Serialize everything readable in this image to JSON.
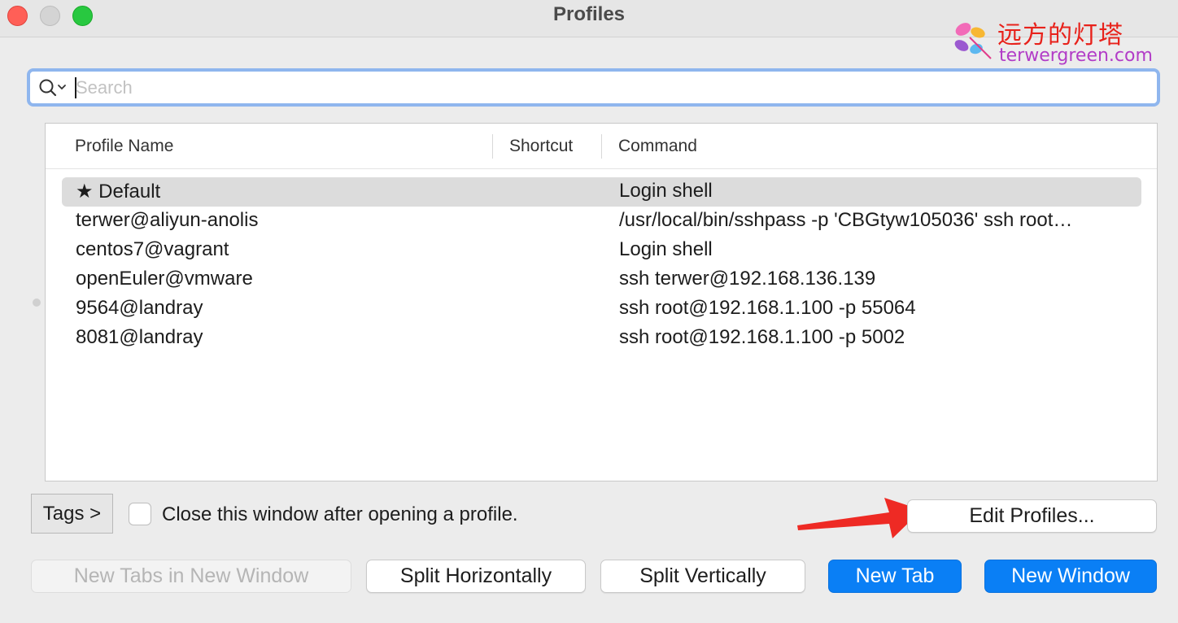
{
  "window": {
    "title": "Profiles"
  },
  "watermark": {
    "chinese": "远方的灯塔",
    "site": "terwergreen.com"
  },
  "search": {
    "placeholder": "Search",
    "value": ""
  },
  "table": {
    "headers": {
      "name": "Profile Name",
      "shortcut": "Shortcut",
      "command": "Command"
    },
    "rows": [
      {
        "name": "★ Default",
        "shortcut": "",
        "command": "Login shell",
        "selected": true
      },
      {
        "name": "terwer@aliyun-anolis",
        "shortcut": "",
        "command": "/usr/local/bin/sshpass -p 'CBGtyw105036' ssh root…"
      },
      {
        "name": "centos7@vagrant",
        "shortcut": "",
        "command": "Login shell"
      },
      {
        "name": "openEuler@vmware",
        "shortcut": "",
        "command": "ssh terwer@192.168.136.139"
      },
      {
        "name": "9564@landray",
        "shortcut": "",
        "command": "ssh root@192.168.1.100 -p 55064"
      },
      {
        "name": "8081@landray",
        "shortcut": "",
        "command": "ssh root@192.168.1.100 -p 5002"
      }
    ]
  },
  "controls": {
    "tags_label": "Tags >",
    "close_after_label": "Close this window after opening a profile.",
    "close_after_checked": false,
    "edit_profiles_label": "Edit Profiles...",
    "new_tabs_new_window_label": "New Tabs in New Window",
    "split_horizontally_label": "Split Horizontally",
    "split_vertically_label": "Split Vertically",
    "new_tab_label": "New Tab",
    "new_window_label": "New Window"
  },
  "colors": {
    "accent_blue": "#0a7ff5",
    "arrow_red": "#ee2a24",
    "selection_gray": "#dcdcdc"
  }
}
